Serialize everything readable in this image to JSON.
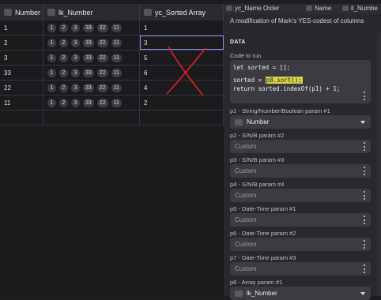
{
  "grid": {
    "headers": [
      "Number",
      "lk_Number",
      "yc_Sorted Array"
    ],
    "rows": [
      {
        "num": "1",
        "sorted": "1"
      },
      {
        "num": "2",
        "sorted": "3"
      },
      {
        "num": "3",
        "sorted": "5"
      },
      {
        "num": "33",
        "sorted": "6"
      },
      {
        "num": "22",
        "sorted": "4"
      },
      {
        "num": "11",
        "sorted": "2"
      }
    ],
    "pills": [
      "1",
      "2",
      "3",
      "33",
      "22",
      "11"
    ]
  },
  "panel": {
    "tabs": [
      "yc_Name Order",
      "Name",
      "il_Numbe"
    ],
    "description": "A modification of Mark's YES-codest of columns",
    "section": "DATA",
    "code_label": "Code to run",
    "code": {
      "l1": "let sorted = [];",
      "l2_pre": "sorted = ",
      "l2_hl": "p8.sort();",
      "l3": "return sorted.indexOf(p1) + 1;"
    },
    "params": [
      {
        "label": "p1 - String/Number/Boolean param #1",
        "value": "Number",
        "type": "select"
      },
      {
        "label": "p2 - S/N/B param #2",
        "value": "Custom",
        "type": "input"
      },
      {
        "label": "p3 - S/N/B param #3",
        "value": "Custom",
        "type": "input"
      },
      {
        "label": "p4 - S/N/B param #4",
        "value": "Custom",
        "type": "input"
      },
      {
        "label": "p5 - Date-Time param #1",
        "value": "Custom",
        "type": "input"
      },
      {
        "label": "p6 - Date-Time param #2",
        "value": "Custom",
        "type": "input"
      },
      {
        "label": "p7 - Date-Time param #3",
        "value": "Custom",
        "type": "input"
      },
      {
        "label": "p8 - Array param #1",
        "value": "lk_Number",
        "type": "select"
      }
    ]
  },
  "colors": {
    "accent": "#8b8cf5",
    "annotation": "#e0202a",
    "highlight": "#d9d24a"
  }
}
